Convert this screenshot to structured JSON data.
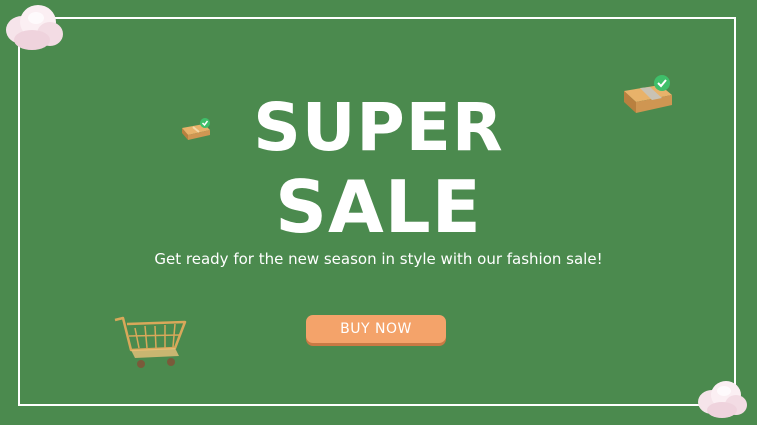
{
  "banner": {
    "title_line1": "SUPER",
    "title_line2": "SALE",
    "subtitle": "Get ready for the new season in style with our fashion sale!",
    "cta_label": "BUY NOW"
  },
  "colors": {
    "background": "#4b8a4e",
    "frame": "#ffffff",
    "text": "#ffffff",
    "cta_background": "#f4a36a"
  },
  "icons": [
    "cloud-icon",
    "package-check-icon",
    "shopping-cart-icon"
  ]
}
